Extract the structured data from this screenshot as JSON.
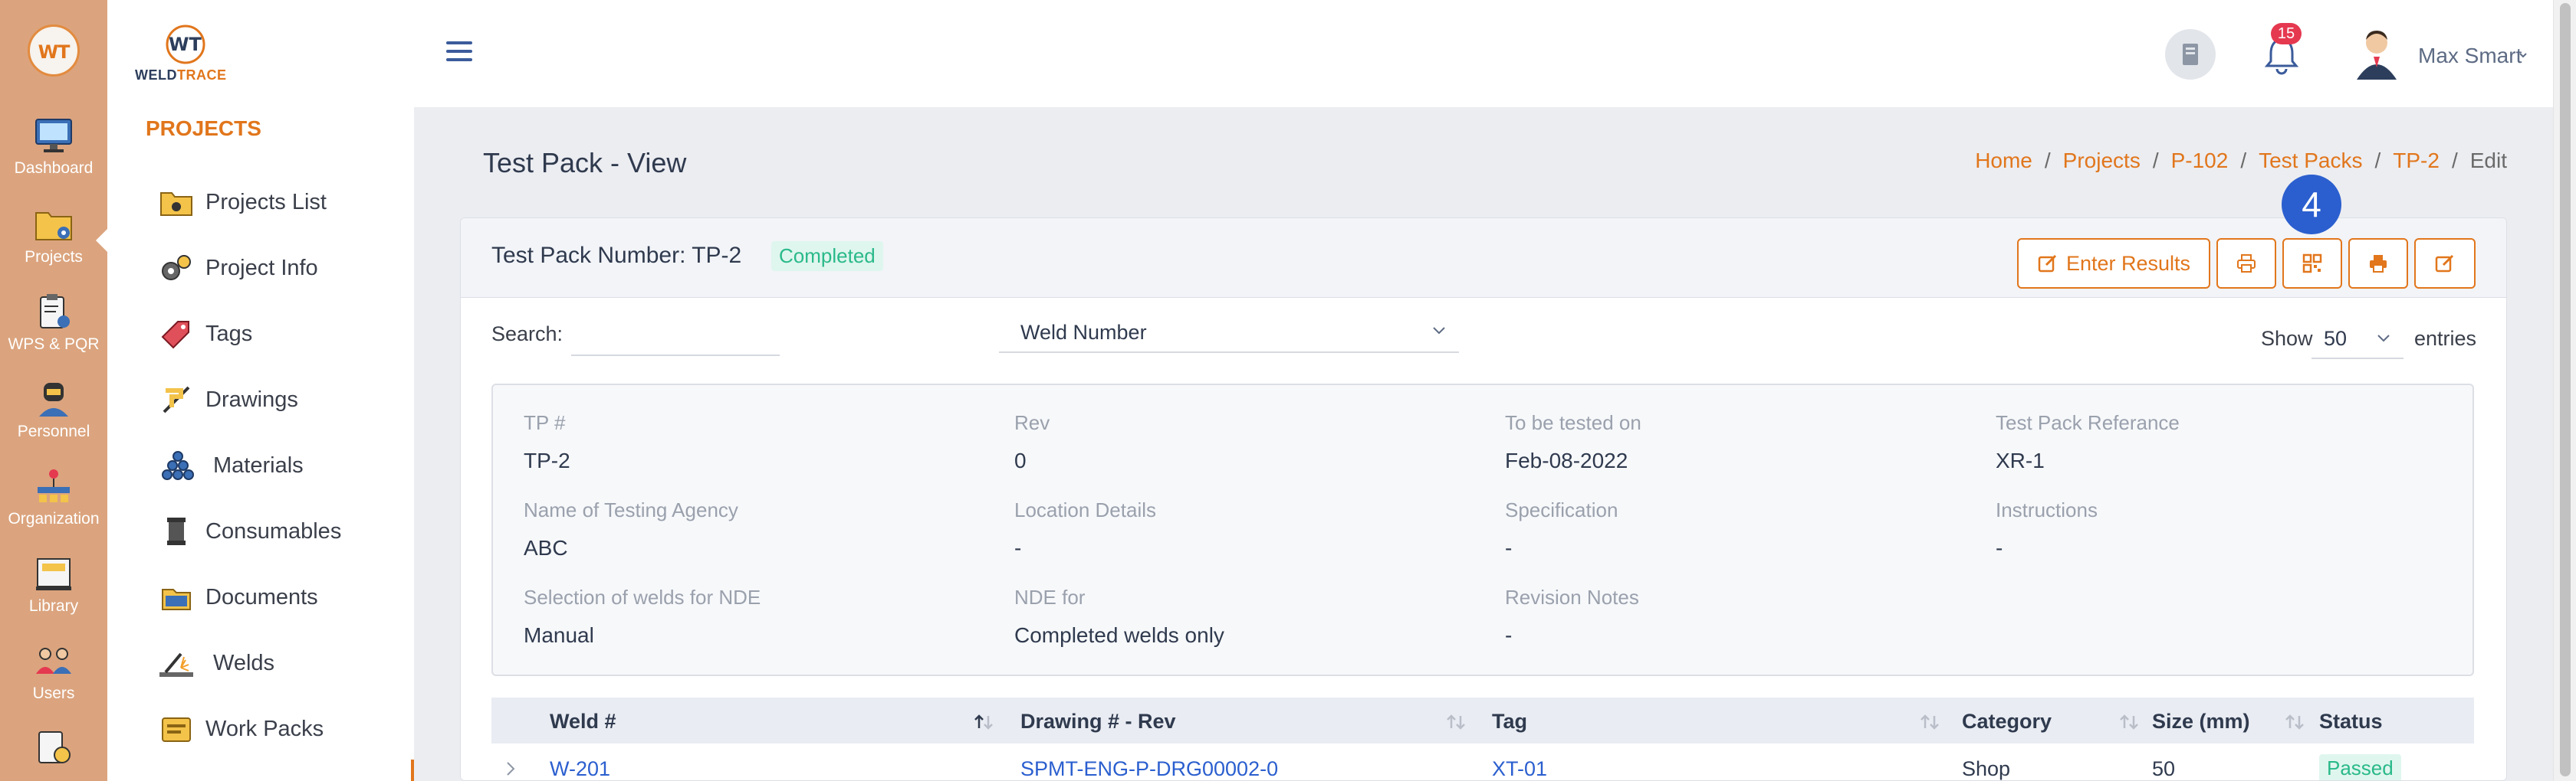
{
  "app": {
    "rail_logo": "WT",
    "brand": {
      "logo_text": "WT",
      "word_a": "WELD",
      "word_b": "TRACE"
    }
  },
  "rail": {
    "items": [
      {
        "label": "Dashboard",
        "icon": "monitor-icon"
      },
      {
        "label": "Projects",
        "icon": "project-folder-icon"
      },
      {
        "label": "WPS & PQR",
        "icon": "clipboard-gear-icon"
      },
      {
        "label": "Personnel",
        "icon": "welder-icon"
      },
      {
        "label": "Organization",
        "icon": "org-chart-icon"
      },
      {
        "label": "Library",
        "icon": "library-icon"
      },
      {
        "label": "Users",
        "icon": "users-icon"
      }
    ]
  },
  "sidebar": {
    "title": "PROJECTS",
    "items": [
      {
        "label": "Projects List",
        "icon": "folder-icon"
      },
      {
        "label": "Project Info",
        "icon": "gears-icon"
      },
      {
        "label": "Tags",
        "icon": "tag-icon"
      },
      {
        "label": "Drawings",
        "icon": "drawing-icon"
      },
      {
        "label": "Materials",
        "icon": "pipes-icon"
      },
      {
        "label": "Consumables",
        "icon": "spool-icon"
      },
      {
        "label": "Documents",
        "icon": "documents-icon"
      },
      {
        "label": "Welds",
        "icon": "weld-spark-icon"
      },
      {
        "label": "Work Packs",
        "icon": "work-pack-icon"
      }
    ]
  },
  "topbar": {
    "notifications_count": "15",
    "user_name": "Max Smart"
  },
  "page": {
    "title": "Test Pack - View",
    "breadcrumb": [
      "Home",
      "Projects",
      "P-102",
      "Test Packs",
      "TP-2"
    ],
    "breadcrumb_current": "Edit"
  },
  "card": {
    "title": "Test Pack Number: TP-2",
    "status": "Completed",
    "enter_results_label": "Enter Results",
    "step_badge": "4"
  },
  "filters": {
    "search_label": "Search:",
    "search_value": "",
    "field_select": "Weld Number",
    "show_label": "Show",
    "show_value": "50",
    "entries_label": "entries"
  },
  "info": {
    "tp_no": {
      "k": "TP #",
      "v": "TP-2"
    },
    "rev": {
      "k": "Rev",
      "v": "0"
    },
    "test_date": {
      "k": "To be tested on",
      "v": "Feb-08-2022"
    },
    "reference": {
      "k": "Test Pack Referance",
      "v": "XR-1"
    },
    "agency": {
      "k": "Name of Testing Agency",
      "v": "ABC"
    },
    "location": {
      "k": "Location Details",
      "v": "-"
    },
    "spec": {
      "k": "Specification",
      "v": "-"
    },
    "instructions": {
      "k": "Instructions",
      "v": "-"
    },
    "nde_selection": {
      "k": "Selection of welds for NDE",
      "v": "Manual"
    },
    "nde_for": {
      "k": "NDE for",
      "v": "Completed welds only"
    },
    "revision_notes": {
      "k": "Revision Notes",
      "v": "-"
    }
  },
  "table": {
    "columns": [
      "Weld #",
      "Drawing # - Rev",
      "Tag",
      "Category",
      "Size (mm)",
      "Status"
    ],
    "rows": [
      {
        "weld": "W-201",
        "drawing": "SPMT-ENG-P-DRG00002-0",
        "tag": "XT-01",
        "category": "Shop",
        "size": "50",
        "status": "Passed"
      }
    ]
  },
  "colors": {
    "accent": "#e1761c",
    "rail_bg": "#dba47e",
    "link": "#2b5fcf",
    "success": "#2ab98a",
    "badge": "#e53950",
    "step_badge": "#2b5fcf"
  }
}
